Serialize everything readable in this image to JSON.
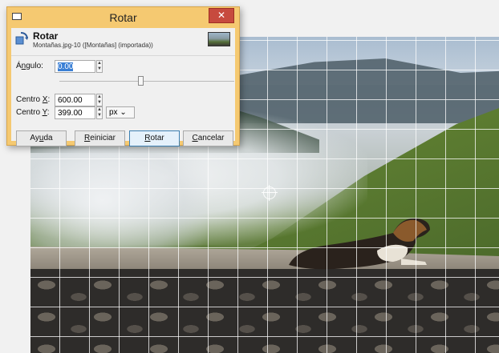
{
  "dialog": {
    "window_title": "Rotar",
    "close_label": "✕",
    "header": {
      "title": "Rotar",
      "subtitle": "Montañas.jpg-10 ([Montañas] (importada))"
    },
    "angle": {
      "label_prefix": "Á",
      "label_mnemonic": "n",
      "label_suffix": "gulo:",
      "value": "0.00"
    },
    "angle_slider_fraction": 0.5,
    "center_x": {
      "label_prefix": "Centro ",
      "label_mnemonic": "X",
      "label_suffix": ":",
      "value": "600.00"
    },
    "center_y": {
      "label_prefix": "Centro ",
      "label_mnemonic": "Y",
      "label_suffix": ":",
      "value": "399.00"
    },
    "unit": {
      "value": "px",
      "arrow": "⌄"
    },
    "buttons": {
      "help": {
        "prefix": "Ay",
        "mnemonic": "u",
        "suffix": "da"
      },
      "reset": {
        "prefix": "",
        "mnemonic": "R",
        "suffix": "einiciar"
      },
      "rotate": {
        "prefix": "",
        "mnemonic": "R",
        "suffix": "otar"
      },
      "cancel": {
        "prefix": "",
        "mnemonic": "C",
        "suffix": "ancelar"
      }
    }
  },
  "canvas": {
    "description_icon": "mountain-dog-photo",
    "grid_color": "#ffffff",
    "center_marker": "crosshair-circle-icon"
  },
  "colors": {
    "dialog_frame": "#f5c971",
    "close_button": "#c74a3e",
    "selection": "#3a7fd5"
  }
}
